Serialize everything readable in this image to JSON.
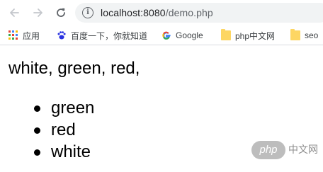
{
  "browser": {
    "url_host": "localhost:8080",
    "url_path": "/demo.php",
    "icons": {
      "back": "arrow-left-icon",
      "forward": "arrow-right-icon",
      "reload": "reload-icon",
      "site_info": "info-icon"
    }
  },
  "bookmarks": [
    {
      "label": "应用",
      "icon": "apps-grid-icon"
    },
    {
      "label": "百度一下，你就知道",
      "icon": "baidu-paw-icon"
    },
    {
      "label": "Google",
      "icon": "google-g-icon"
    },
    {
      "label": "php中文网",
      "icon": "folder-icon"
    },
    {
      "label": "seo",
      "icon": "folder-icon"
    }
  ],
  "page": {
    "line": "white, green, red,",
    "list_items": [
      "green",
      "red",
      "white"
    ]
  },
  "watermark": {
    "badge_text": "php",
    "text": "中文网"
  },
  "colors": {
    "toolbar_bg": "#ffffff",
    "omnibox_bg": "#f1f3f4",
    "icon_gray": "#5f6368",
    "folder_yellow": "#fdd663"
  }
}
